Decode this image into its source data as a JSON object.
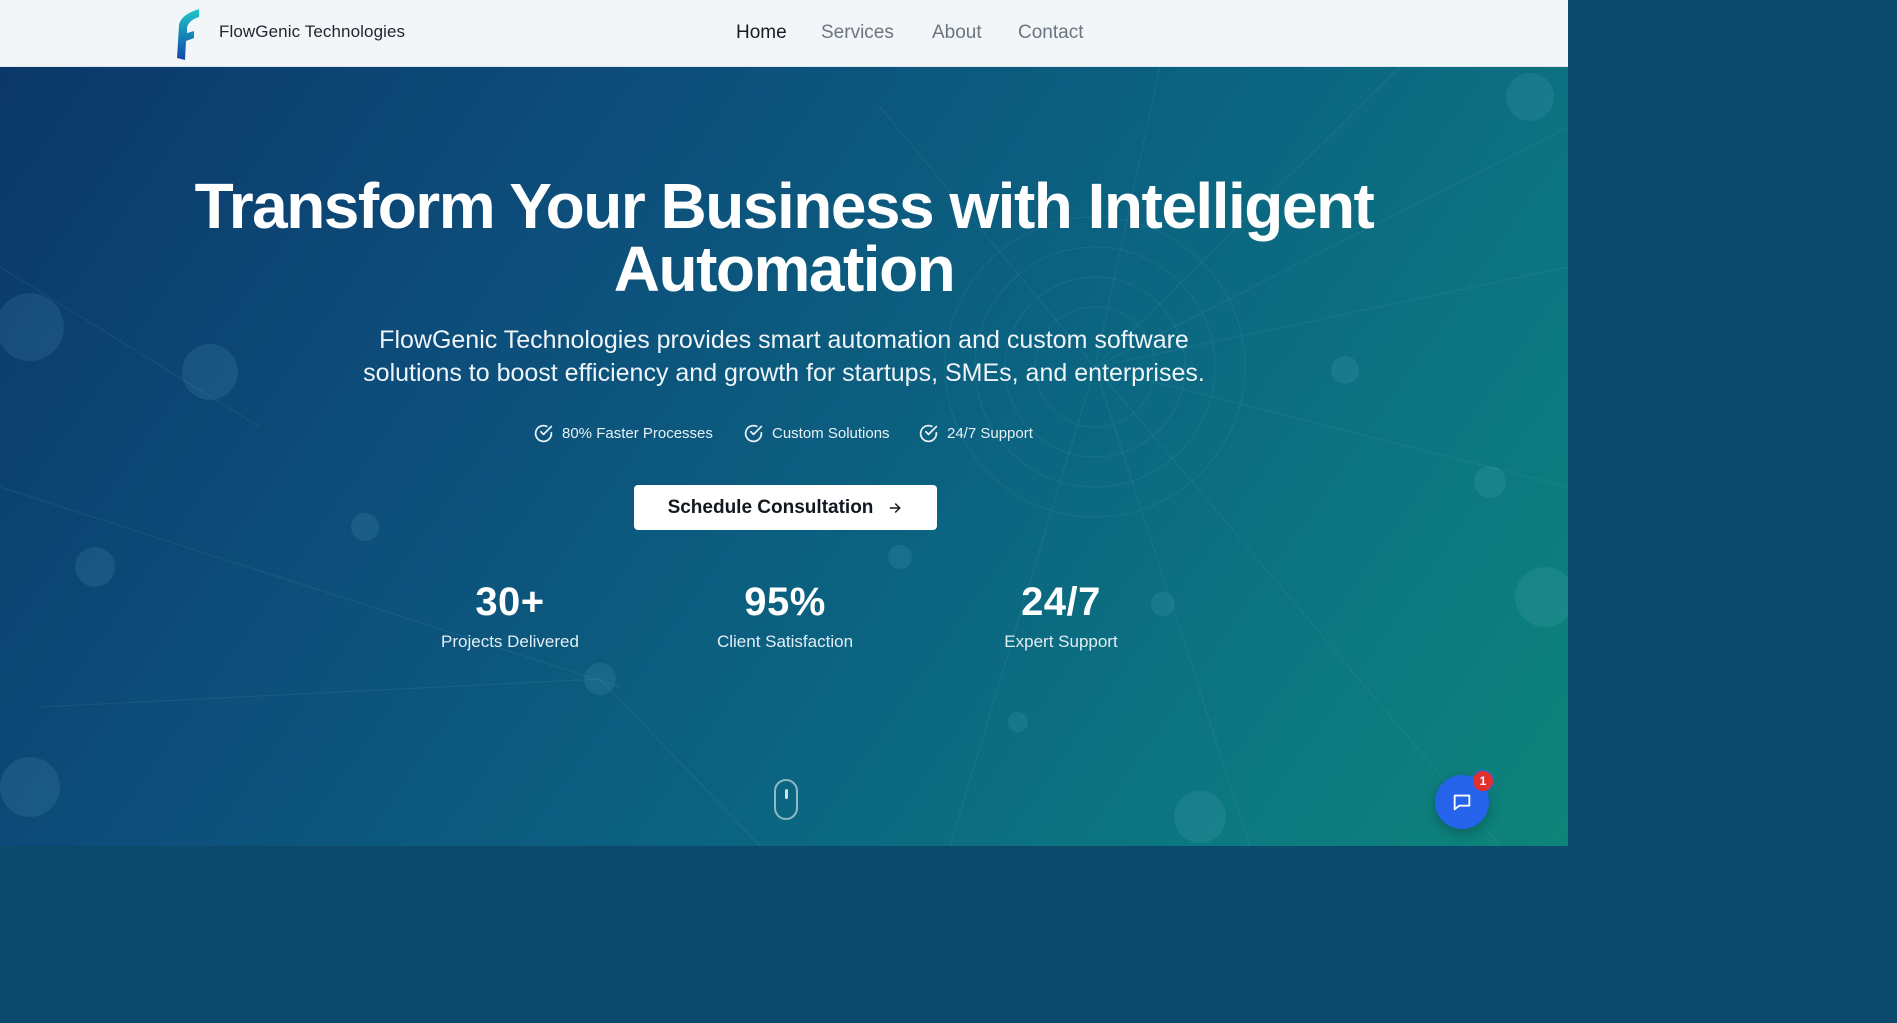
{
  "header": {
    "brand": "FlowGenic Technologies",
    "nav": [
      {
        "label": "Home",
        "active": true
      },
      {
        "label": "Services",
        "active": false
      },
      {
        "label": "About",
        "active": false
      },
      {
        "label": "Contact",
        "active": false
      }
    ]
  },
  "hero": {
    "title_line1": "Transform Your Business with Intelligent",
    "title_line2": "Automation",
    "subtitle_line1": "FlowGenic Technologies provides smart automation and custom software",
    "subtitle_line2": "solutions to boost efficiency and growth for startups, SMEs, and enterprises.",
    "features": [
      "80% Faster Processes",
      "Custom Solutions",
      "24/7 Support"
    ],
    "cta_label": "Schedule Consultation",
    "stats": [
      {
        "value": "30+",
        "label": "Projects Delivered"
      },
      {
        "value": "95%",
        "label": "Client Satisfaction"
      },
      {
        "value": "24/7",
        "label": "Expert Support"
      }
    ]
  },
  "chat": {
    "badge_count": "1"
  },
  "colors": {
    "accent_blue": "#2563eb",
    "badge_red": "#e0312e",
    "hero_gradient_start": "#0b3868",
    "hero_gradient_end": "#0e8479"
  },
  "icons": {
    "logo": "flowgenic-logo",
    "feature": "check-circle-icon",
    "cta": "arrow-right-icon",
    "scroll": "mouse-scroll-icon",
    "chat": "chat-bubble-icon"
  }
}
